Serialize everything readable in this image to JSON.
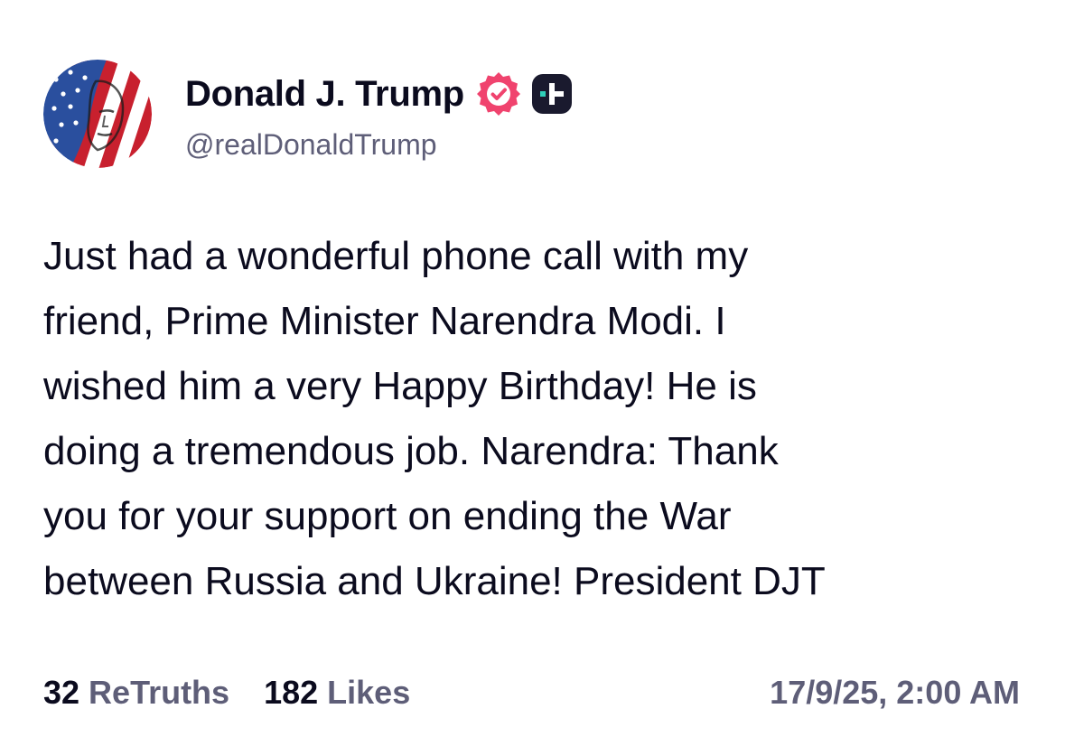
{
  "author": {
    "display_name": "Donald J. Trump",
    "handle": "@realDonaldTrump",
    "avatar_icon": "avatar-flag-portrait",
    "verified_icon": "verified-badge-icon",
    "verified_color": "#f0436e",
    "plus_icon": "truth-plus-icon",
    "plus_color": "#1a1a2e"
  },
  "post": {
    "text": "Just had a wonderful phone call with my\nfriend, Prime Minister Narendra Modi. I\nwished him a very Happy Birthday! He is\ndoing a tremendous job. Narendra: Thank\nyou for your support on ending the War\nbetween Russia and Ukraine! President DJT"
  },
  "stats": {
    "retruths_count": "32",
    "retruths_label": "ReTruths",
    "likes_count": "182",
    "likes_label": "Likes",
    "timestamp": "17/9/25, 2:00 AM"
  }
}
